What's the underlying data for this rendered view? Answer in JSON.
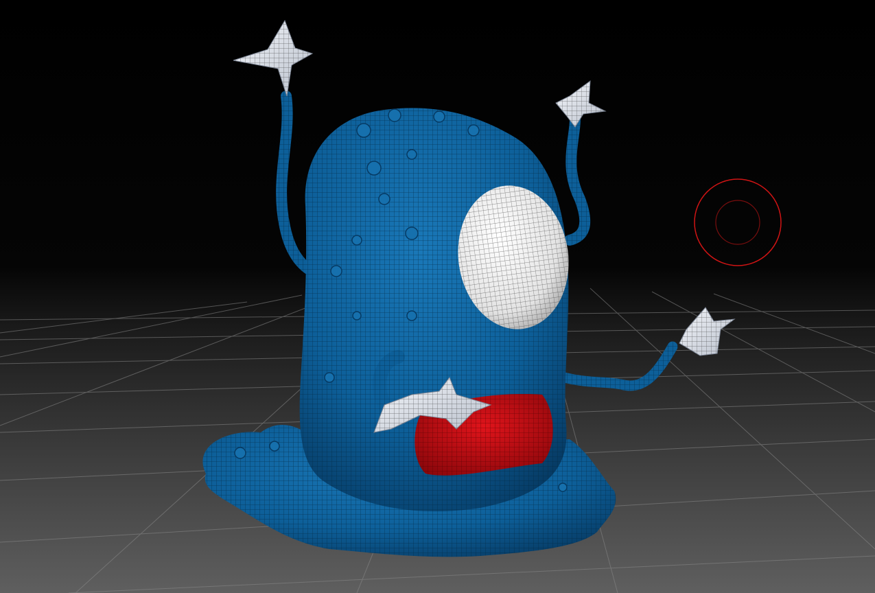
{
  "viewport": {
    "background_top": "#000000",
    "background_bottom": "#5f5f5f",
    "floor_grid": true,
    "grid_line_color": "#8a8a8a"
  },
  "model": {
    "name": "",
    "wireframe": true,
    "colors": {
      "body": "#0d5f99",
      "body_dark": "#063a63",
      "eye": "#e8e8e8",
      "mouth": "#c40d13",
      "tentacle_tips": "#dfe3ea"
    }
  },
  "brush_cursor": {
    "color": "#d01414",
    "icon": "brush-cursor-icon"
  }
}
